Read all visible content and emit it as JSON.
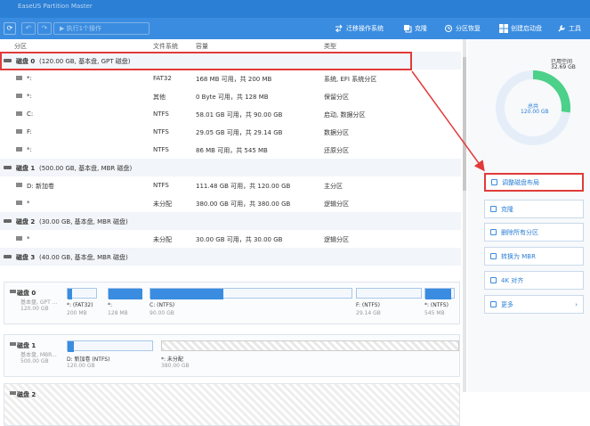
{
  "titlebar": {
    "title": "EaseUS Partition Master"
  },
  "toolbar": {
    "refresh": "⟳",
    "undo": "↶",
    "redo": "↷",
    "run": "▶ 执行1个操作",
    "items": [
      {
        "label": "迁移操作系统",
        "icon": "migrate-os-icon"
      },
      {
        "label": "克隆",
        "icon": "clone-icon"
      },
      {
        "label": "分区恢复",
        "icon": "partition-recovery-icon"
      },
      {
        "label": "创建启动盘",
        "icon": "windows-icon"
      },
      {
        "label": "工具",
        "icon": "wrench-icon"
      }
    ]
  },
  "table": {
    "headers": [
      "分区",
      "文件系统",
      "容量",
      "类型"
    ],
    "rows": [
      {
        "kind": "disk",
        "name": "磁盘 0",
        "info": " (120.00 GB, 基本盘, GPT 磁盘)",
        "fs": "",
        "cap": "",
        "type": ""
      },
      {
        "kind": "part",
        "name": "*:",
        "fs": "FAT32",
        "cap": "168 MB  可用，共  200 MB",
        "type": "系统, EFI 系统分区"
      },
      {
        "kind": "part",
        "name": "*:",
        "fs": "其他",
        "cap": "0 Byte  可用，共  128 MB",
        "type": "保留分区"
      },
      {
        "kind": "part",
        "name": "C:",
        "fs": "NTFS",
        "cap": "58.01 GB  可用，共  90.00 GB",
        "type": "启动, 数据分区"
      },
      {
        "kind": "part",
        "name": "F:",
        "fs": "NTFS",
        "cap": "29.05 GB  可用，共  29.14 GB",
        "type": "数据分区"
      },
      {
        "kind": "part",
        "name": "*:",
        "fs": "NTFS",
        "cap": "86 MB  可用，共  545 MB",
        "type": "还原分区"
      },
      {
        "kind": "disk",
        "name": "磁盘 1",
        "info": " (500.00 GB, 基本盘, MBR 磁盘)",
        "fs": "",
        "cap": "",
        "type": ""
      },
      {
        "kind": "part",
        "name": "D: 新加卷",
        "fs": "NTFS",
        "cap": "111.48 GB  可用，共  120.00 GB",
        "type": "主分区"
      },
      {
        "kind": "part",
        "name": "*",
        "fs": "未分配",
        "cap": "380.00 GB  可用，共  380.00 GB",
        "type": "逻辑分区"
      },
      {
        "kind": "disk",
        "name": "磁盘 2",
        "info": " (30.00 GB, 基本盘, MBR 磁盘)",
        "fs": "",
        "cap": "",
        "type": ""
      },
      {
        "kind": "part",
        "name": "*",
        "fs": "未分配",
        "cap": "30.00 GB  可用，共  30.00 GB",
        "type": "逻辑分区"
      },
      {
        "kind": "disk",
        "name": "磁盘 3",
        "info": " (40.00 GB, 基本盘, MBR 磁盘)",
        "fs": "",
        "cap": "",
        "type": ""
      }
    ]
  },
  "maps": [
    {
      "name": "磁盘 0",
      "type": "基本盘, GPT ...",
      "size": "120.00 GB",
      "segs": [
        {
          "n": "*: (FAT32)",
          "s": "200 MB",
          "fill": 0.16,
          "un": false
        },
        {
          "n": "*:",
          "s": "128 MB",
          "fill": 1.0,
          "un": false
        },
        {
          "n": "C: (NTFS)",
          "s": "90.00 GB",
          "fill": 0.36,
          "un": false
        },
        {
          "n": "F: (NTFS)",
          "s": "29.14 GB",
          "fill": 0.0,
          "un": false
        },
        {
          "n": "*: (NTFS)",
          "s": "545 MB",
          "fill": 0.84,
          "un": false
        }
      ]
    },
    {
      "name": "磁盘 1",
      "type": "基本盘, MBR...",
      "size": "500.00 GB",
      "segs": [
        {
          "n": "D: 新加卷 (NTFS)",
          "s": "120.00 GB",
          "fill": 0.07,
          "un": false
        },
        {
          "n": "*: 未分配",
          "s": "380.00 GB",
          "fill": 0,
          "un": true
        }
      ]
    },
    {
      "name": "磁盘 2",
      "type": "",
      "size": "",
      "segs": []
    }
  ],
  "sidebar": {
    "used_label": "已用空间",
    "used_value": "32.69 GB",
    "total_label": "总共",
    "total_value": "120.00 GB",
    "used_fraction": 0.27,
    "actions": [
      {
        "label": "调整磁盘布局",
        "icon": "resize-icon"
      },
      {
        "label": "克隆",
        "icon": "clone-icon"
      },
      {
        "label": "删除所有分区",
        "icon": "trash-icon"
      },
      {
        "label": "转换为 MBR",
        "icon": "convert-icon"
      },
      {
        "label": "4K 对齐",
        "icon": "align-icon"
      },
      {
        "label": "更多",
        "icon": "more-icon"
      }
    ]
  },
  "colors": {
    "accent": "#3a8ce0",
    "ring": "#4cd08a",
    "highlight": "#e23a3a"
  }
}
